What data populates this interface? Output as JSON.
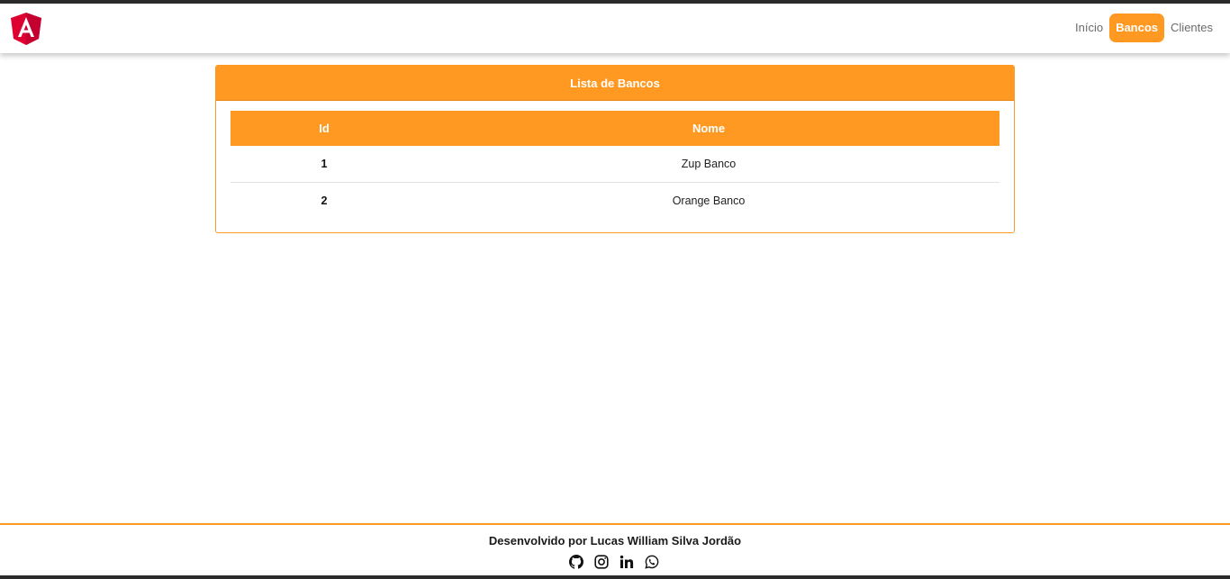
{
  "navbar": {
    "logo_icon": "angular-logo-icon",
    "links": [
      {
        "label": "Início",
        "active": false
      },
      {
        "label": "Bancos",
        "active": true
      },
      {
        "label": "Clientes",
        "active": false
      }
    ]
  },
  "card": {
    "title": "Lista de Bancos",
    "table": {
      "headers": {
        "id": "Id",
        "name": "Nome"
      },
      "rows": [
        {
          "id": "1",
          "name": "Zup Banco"
        },
        {
          "id": "2",
          "name": "Orange Banco"
        }
      ]
    }
  },
  "footer": {
    "text": "Desenvolvido por Lucas William Silva Jordão",
    "social_icons": [
      "github-icon",
      "instagram-icon",
      "linkedin-icon",
      "whatsapp-icon"
    ]
  },
  "colors": {
    "accent": "#ff9922",
    "logo_red": "#dd0031"
  }
}
